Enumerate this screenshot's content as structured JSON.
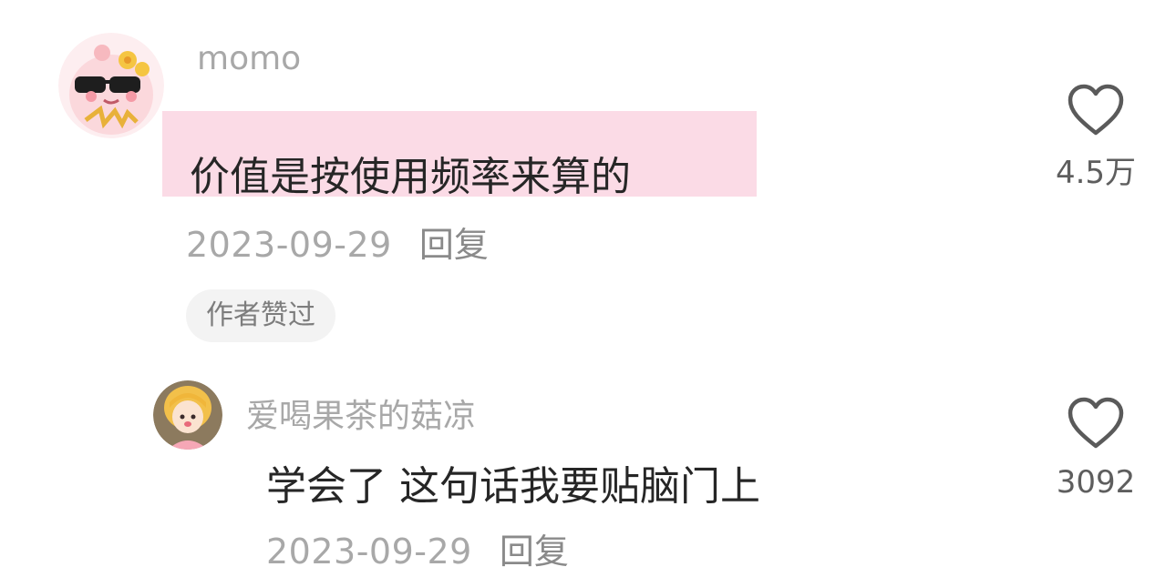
{
  "comment": {
    "username": "momo",
    "text": "价值是按使用频率来算的",
    "date": "2023-09-29",
    "reply_label": "回复",
    "badge": "作者赞过",
    "like_count": "4.5万",
    "avatar_icon": "cartoon-sunglasses-avatar",
    "highlight_color": "#fbdbe6"
  },
  "reply": {
    "username": "爱喝果茶的菇凉",
    "text": "学会了 这句话我要贴脑门上",
    "date": "2023-09-29",
    "reply_label": "回复",
    "like_count": "3092",
    "avatar_icon": "cartoon-girl-avatar"
  },
  "colors": {
    "text_primary": "#262626",
    "text_secondary": "#a8a8a8",
    "badge_bg": "#f3f3f3"
  }
}
